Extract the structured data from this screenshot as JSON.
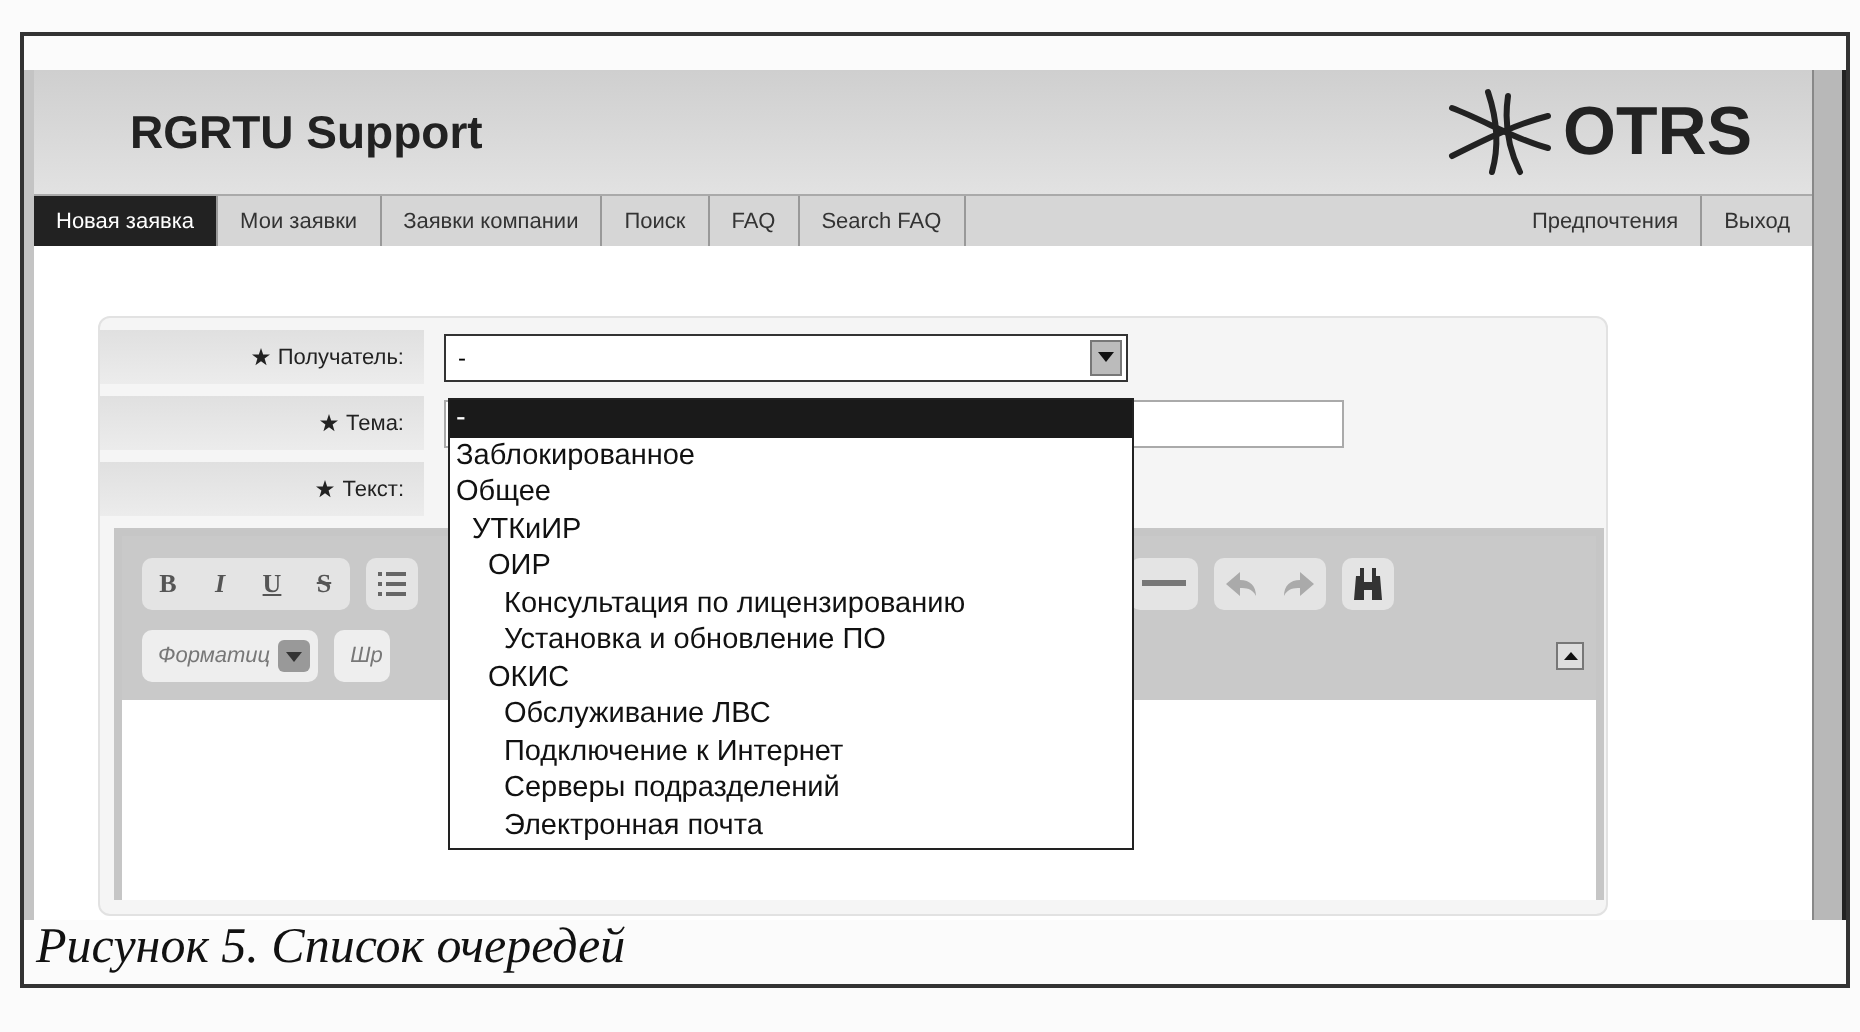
{
  "header": {
    "title": "RGRTU Support",
    "logo_text": "OTRS"
  },
  "nav": {
    "tabs": [
      {
        "label": "Новая заявка",
        "selected": true
      },
      {
        "label": "Мои заявки",
        "selected": false
      },
      {
        "label": "Заявки компании",
        "selected": false
      },
      {
        "label": "Поиск",
        "selected": false
      },
      {
        "label": "FAQ",
        "selected": false
      },
      {
        "label": "Search FAQ",
        "selected": false
      }
    ],
    "right_tabs": [
      {
        "label": "Предпочтения",
        "selected": false
      },
      {
        "label": "Выход",
        "selected": false
      }
    ]
  },
  "form": {
    "fields": [
      {
        "kind": "select",
        "label": "Получатель:",
        "required": true,
        "value": "-"
      },
      {
        "kind": "text",
        "label": "Тема:",
        "required": true
      },
      {
        "kind": "editor",
        "label": "Текст:",
        "required": true
      }
    ]
  },
  "editor": {
    "format_buttons": [
      "B",
      "I",
      "U",
      "S"
    ],
    "format_select": "Форматиц",
    "font_select": "Шр"
  },
  "dropdown": {
    "items": [
      {
        "label": "-",
        "selected": true
      },
      {
        "label": "Заблокированное",
        "selected": false
      },
      {
        "label": "Общее",
        "selected": false,
        "children": [
          {
            "label": "УТКиИР",
            "selected": false,
            "children": [
              {
                "label": "ОИР",
                "selected": false,
                "children": [
                  {
                    "label": "Консультация по лицензированию",
                    "selected": false
                  },
                  {
                    "label": "Установка и обновление ПО",
                    "selected": false
                  }
                ]
              },
              {
                "label": "ОКИС",
                "selected": false,
                "children": [
                  {
                    "label": "Обслуживание ЛВС",
                    "selected": false
                  },
                  {
                    "label": "Подключение к Интернет",
                    "selected": false
                  },
                  {
                    "label": "Серверы подразделений",
                    "selected": false
                  },
                  {
                    "label": "Электронная почта",
                    "selected": false
                  }
                ]
              }
            ]
          }
        ]
      }
    ]
  },
  "caption": "Рисунок 5. Список очередей"
}
